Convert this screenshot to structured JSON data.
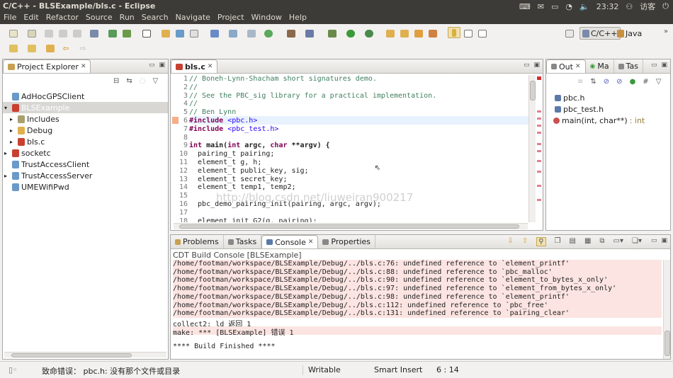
{
  "window": {
    "title": "C/C++ - BLSExample/bls.c - Eclipse"
  },
  "tray": {
    "clock": "23:32",
    "user": "访客"
  },
  "menu": [
    "File",
    "Edit",
    "Refactor",
    "Source",
    "Run",
    "Search",
    "Navigate",
    "Project",
    "Window",
    "Help"
  ],
  "perspectives": {
    "cpp": "C/C++",
    "java": "Java"
  },
  "project_explorer": {
    "tab": "Project Explorer",
    "items": [
      {
        "label": "AdHocGPSClient",
        "indent": 0
      },
      {
        "label": "BLSExample",
        "indent": 0,
        "selected": true
      },
      {
        "label": "Includes",
        "indent": 1
      },
      {
        "label": "Debug",
        "indent": 1
      },
      {
        "label": "bls.c",
        "indent": 1
      },
      {
        "label": "socketc",
        "indent": 0
      },
      {
        "label": "TrustAccessClient",
        "indent": 0
      },
      {
        "label": "TrustAccessServer",
        "indent": 0
      },
      {
        "label": "UMEWifiPwd",
        "indent": 0
      }
    ]
  },
  "editor": {
    "tab": "bls.c",
    "lines": [
      {
        "n": "1",
        "text": "// Boneh-Lynn-Shacham short signatures demo.",
        "kind": "cm"
      },
      {
        "n": "2",
        "text": "//",
        "kind": "cm"
      },
      {
        "n": "3",
        "text": "// See the PBC_sig library for a practical implementation.",
        "kind": "cm"
      },
      {
        "n": "4",
        "text": "//",
        "kind": "cm"
      },
      {
        "n": "5",
        "text": "// Ben Lynn",
        "kind": "cm"
      },
      {
        "n": "6",
        "text": "#include <pbc.h>",
        "kind": "pp"
      },
      {
        "n": "7",
        "text": "#include <pbc_test.h>",
        "kind": "pp"
      },
      {
        "n": "8",
        "text": "",
        "kind": "plain"
      },
      {
        "n": "9",
        "text": "int main(int argc, char **argv) {",
        "kind": "plain"
      },
      {
        "n": "10",
        "text": "  pairing_t pairing;",
        "kind": "plain"
      },
      {
        "n": "11",
        "text": "  element_t g, h;",
        "kind": "plain"
      },
      {
        "n": "12",
        "text": "  element_t public_key, sig;",
        "kind": "plain"
      },
      {
        "n": "13",
        "text": "  element_t secret_key;",
        "kind": "plain"
      },
      {
        "n": "14",
        "text": "  element_t temp1, temp2;",
        "kind": "plain"
      },
      {
        "n": "15",
        "text": "",
        "kind": "plain"
      },
      {
        "n": "16",
        "text": "  pbc_demo_pairing_init(pairing, argc, argv);",
        "kind": "plain"
      },
      {
        "n": "17",
        "text": "",
        "kind": "plain"
      },
      {
        "n": "18",
        "text": "  element_init_G2(g, pairing);",
        "kind": "plain"
      }
    ],
    "watermark": "http://blog.csdn.net/liuweiran900217"
  },
  "outline": {
    "tabs": [
      "Out",
      "Ma",
      "Tas"
    ],
    "items": [
      {
        "label": "pbc.h",
        "suffix": ""
      },
      {
        "label": "pbc_test.h",
        "suffix": ""
      },
      {
        "label": "main(int, char**)",
        "suffix": " : int"
      }
    ]
  },
  "console": {
    "tabs": [
      "Problems",
      "Tasks",
      "Console",
      "Properties"
    ],
    "header": "CDT Build Console [BLSExample]",
    "lines": [
      {
        "text": "/home/footman/workspace/BLSExample/Debug/../bls.c:76: undefined reference to `element_printf'",
        "err": true
      },
      {
        "text": "/home/footman/workspace/BLSExample/Debug/../bls.c:88: undefined reference to `pbc_malloc'",
        "err": true
      },
      {
        "text": "/home/footman/workspace/BLSExample/Debug/../bls.c:90: undefined reference to `element_to_bytes_x_only'",
        "err": true
      },
      {
        "text": "/home/footman/workspace/BLSExample/Debug/../bls.c:97: undefined reference to `element_from_bytes_x_only'",
        "err": true
      },
      {
        "text": "/home/footman/workspace/BLSExample/Debug/../bls.c:98: undefined reference to `element_printf'",
        "err": true
      },
      {
        "text": "/home/footman/workspace/BLSExample/Debug/../bls.c:112: undefined reference to `pbc_free'",
        "err": true
      },
      {
        "text": "/home/footman/workspace/BLSExample/Debug/../bls.c:131: undefined reference to `pairing_clear'",
        "err": true
      },
      {
        "text": "collect2: ld 返回 1",
        "err": false
      },
      {
        "text": "make: *** [BLSExample] 错误 1",
        "err": true
      },
      {
        "text": "",
        "err": false
      },
      {
        "text": "**** Build Finished ****",
        "err": false
      }
    ]
  },
  "status": {
    "message": "致命错误： pbc.h: 没有那个文件或目录",
    "mode": "Writable",
    "insert": "Smart Insert",
    "position": "6 : 14"
  }
}
